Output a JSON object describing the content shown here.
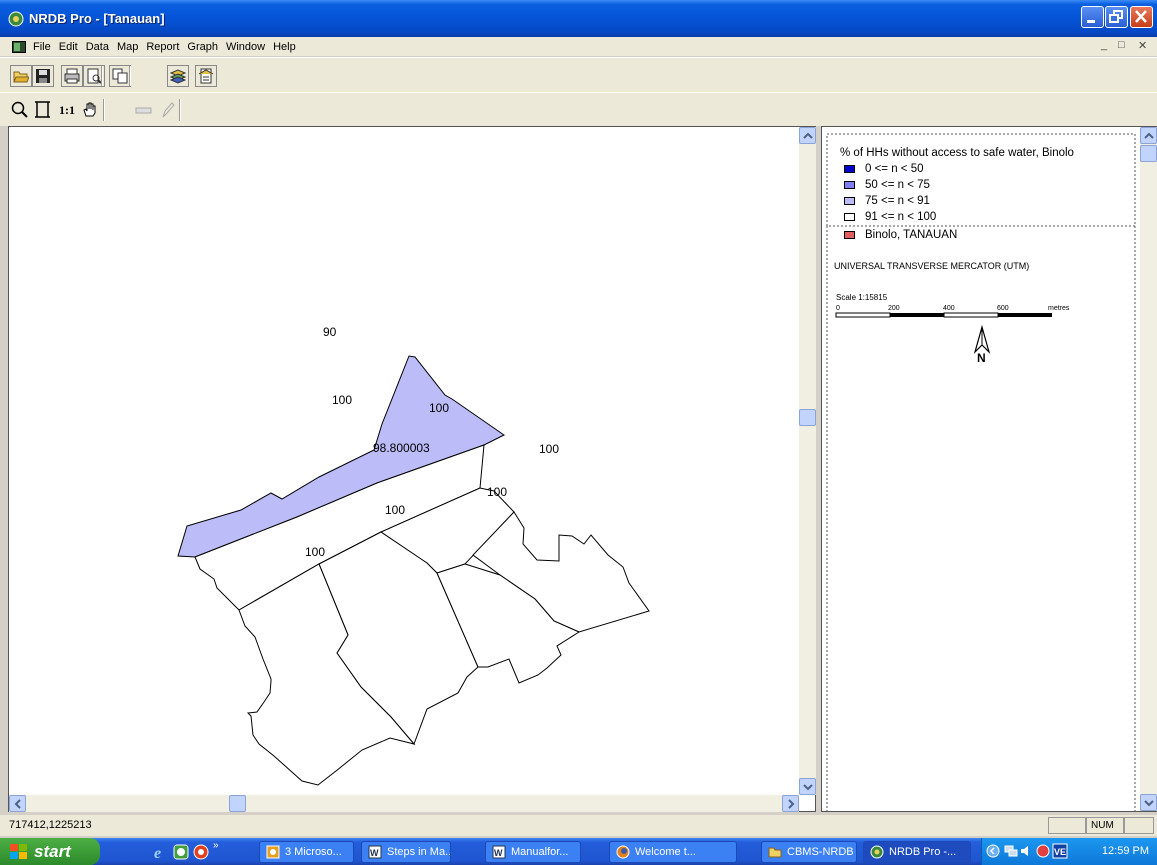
{
  "window": {
    "title": "NRDB Pro - [Tanauan]"
  },
  "menu": [
    "File",
    "Edit",
    "Data",
    "Map",
    "Report",
    "Graph",
    "Window",
    "Help"
  ],
  "map": {
    "labels": {
      "p1": "90",
      "p2": "100",
      "p3": "100",
      "p4": "98.800003",
      "p5": "100",
      "p6": "100",
      "p7": "100",
      "p8": "100"
    }
  },
  "legend": {
    "title": "% of HHs without access to safe water, Binolo",
    "items": [
      {
        "label": "0 <= n < 50",
        "color": "#0000c8"
      },
      {
        "label": "50 <= n < 75",
        "color": "#7f7ff2"
      },
      {
        "label": "75 <= n < 91",
        "color": "#bcbcf8"
      },
      {
        "label": "91 <= n < 100",
        "color": "#ffffff"
      }
    ],
    "boundary": {
      "label": "Binolo, TANAUAN",
      "color": "#e06060"
    },
    "projection": "UNIVERSAL TRANSVERSE MERCATOR (UTM)",
    "scale_label": "Scale 1:15815",
    "scale_ticks": [
      "0",
      "200",
      "400",
      "600"
    ],
    "scale_unit": "metres",
    "north": "N"
  },
  "status": {
    "coords": "717412,1225213",
    "num": "NUM"
  },
  "taskbar": {
    "start": "start",
    "tasks": [
      "3 Microso...",
      "Steps in Ma...",
      "Manualfor...",
      "Welcome t...",
      "CBMS-NRDB",
      "NRDB Pro -..."
    ],
    "clock": "12:59 PM"
  }
}
